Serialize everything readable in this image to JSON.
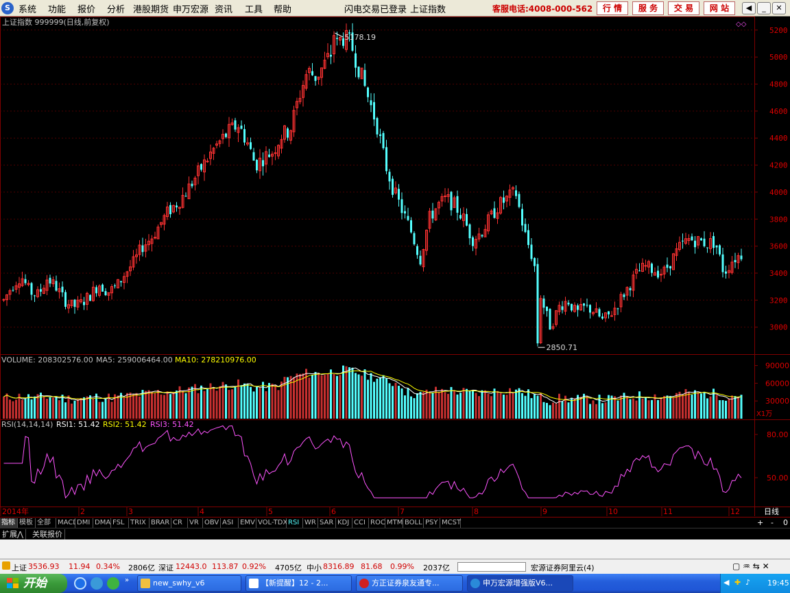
{
  "menu": {
    "items": [
      "系统",
      "功能",
      "报价",
      "分析",
      "港股期货",
      "申万宏源",
      "资讯",
      "工具",
      "帮助"
    ],
    "login_status": "闪电交易已登录",
    "current_index": "上证指数",
    "hotline": "客服电话:4008-000-562",
    "quick_buttons": [
      "行 情",
      "服 务",
      "交 易",
      "网 站"
    ]
  },
  "chart_header": {
    "title": "上证指数 999999(日线,前复权)",
    "high_label": "5178.19",
    "low_label": "2850.71"
  },
  "price_axis": [
    "5200",
    "5000",
    "4800",
    "4600",
    "4400",
    "4200",
    "4000",
    "3800",
    "3600",
    "3400",
    "3200",
    "3000"
  ],
  "volume_header": {
    "volume": "VOLUME: 208302576.00",
    "ma5": "MA5: 259006464.00",
    "ma10": "MA10: 278210976.00"
  },
  "volume_axis": [
    "90000",
    "60000",
    "30000"
  ],
  "volume_unit": "X1万",
  "rsi_header": {
    "name": "RSI(14,14,14)",
    "rsi1": "RSI1: 51.42",
    "rsi2": "RSI2: 51.42",
    "rsi3": "RSI3: 51.42"
  },
  "rsi_axis": [
    "80.00",
    "50.00"
  ],
  "time_axis": [
    "2014年",
    "2",
    "3",
    "4",
    "5",
    "6",
    "7",
    "8",
    "9",
    "10",
    "11",
    "12"
  ],
  "period": "日线",
  "indicator_tabs": [
    "指标",
    "模板",
    "全部",
    "MACD",
    "DMI",
    "DMA",
    "FSL",
    "TRIX",
    "BRAR",
    "CR",
    "VR",
    "OBV",
    "ASI",
    "EMV",
    "VOL-TDX",
    "RSI",
    "WR",
    "SAR",
    "KDJ",
    "CCI",
    "ROC",
    "MTM",
    "BOLL",
    "PSY",
    "MCST"
  ],
  "zoom_controls": [
    "+",
    "-",
    "0"
  ],
  "sub_tabs": [
    "扩展⋀",
    "关联报价"
  ],
  "status": {
    "sh_name": "上证",
    "sh_value": "3536.93",
    "sh_change": "11.94",
    "sh_pct": "0.34%",
    "sh_amount": "2806亿",
    "sz_name": "深证",
    "sz_value": "12443.0",
    "sz_change": "113.87",
    "sz_pct": "0.92%",
    "sz_amount": "4705亿",
    "zx_name": "中小",
    "zx_value": "8316.89",
    "zx_change": "81.68",
    "zx_pct": "0.99%",
    "zx_amount": "2037亿",
    "server": "宏源证券阿里云(4)"
  },
  "taskbar": {
    "start": "开始",
    "windows": [
      "new_swhy_v6",
      "【新提醒】12 - 2...",
      "方正证券泉友通专...",
      "申万宏源增强版V6..."
    ],
    "clock": "19:45"
  },
  "colors": {
    "up": "#ff3232",
    "down": "#54ffff",
    "rsi": "#ff55ff",
    "ma5": "#ffffff",
    "ma10": "#ffff00",
    "grid": "#800000"
  },
  "chart_data": {
    "type": "candlestick",
    "title": "上证指数 999999(日线,前复权)",
    "x_range": [
      "2014-01",
      "2014-12"
    ],
    "price_range": [
      2850.71,
      5178.19
    ],
    "ylim": [
      2800,
      5260
    ],
    "close_path": [
      3200,
      3310,
      3380,
      3260,
      3240,
      3360,
      3300,
      3200,
      3150,
      3180,
      3240,
      3320,
      3260,
      3300,
      3400,
      3480,
      3600,
      3660,
      3760,
      3860,
      3920,
      4000,
      4100,
      4200,
      4300,
      4380,
      4450,
      4500,
      4380,
      4200,
      4260,
      4300,
      4420,
      4460,
      4700,
      4900,
      4850,
      4950,
      5050,
      5150,
      5100,
      4900,
      4700,
      4500,
      4200,
      4000,
      3850,
      3700,
      3500,
      3800,
      3900,
      3950,
      3900,
      3800,
      3650,
      3700,
      3800,
      3900,
      3950,
      4000,
      3700,
      3500,
      3200,
      3000,
      3150,
      3200,
      3100,
      3150,
      3120,
      3050,
      3100,
      3200,
      3300,
      3400,
      3450,
      3420,
      3400,
      3500,
      3600,
      3650,
      3640,
      3620,
      3630,
      3400,
      3500,
      3540
    ],
    "rsi_range": [
      30,
      90
    ],
    "vol_range_wan": [
      0,
      100000
    ]
  }
}
